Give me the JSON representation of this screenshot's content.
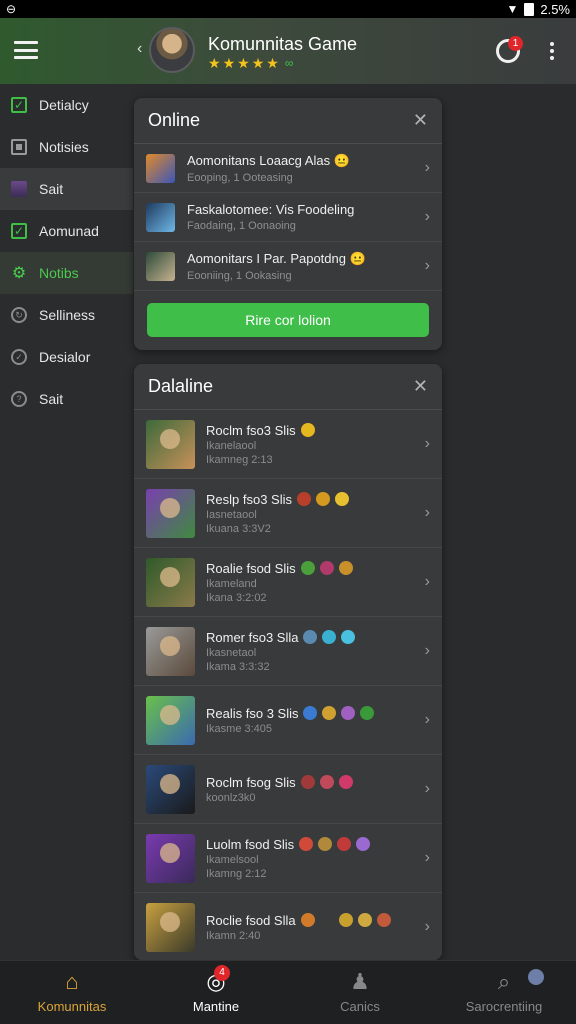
{
  "status_bar": {
    "left_icon": "system-icon",
    "battery": "2.5%"
  },
  "header": {
    "title": "Komunnitas Game",
    "rating_stars": 5,
    "rating_link": "∞",
    "notification_count": "1"
  },
  "sidebar": {
    "items": [
      {
        "label": "Detialcy",
        "icon": "check-icon"
      },
      {
        "label": "Notisies",
        "icon": "square-icon"
      },
      {
        "label": "Sait",
        "icon": "user-icon"
      },
      {
        "label": "Aomunad",
        "icon": "check-icon"
      },
      {
        "label": "Notibs",
        "icon": "gear-icon"
      },
      {
        "label": "Selliness",
        "icon": "circle-icon"
      },
      {
        "label": "Desialor",
        "icon": "circle-icon"
      },
      {
        "label": "Sait",
        "icon": "circle-icon"
      }
    ]
  },
  "online_card": {
    "title": "Online",
    "rows": [
      {
        "title": "Aomonitans Loaacg Alas 😐",
        "sub": "Eooping, 1 Ooteasing"
      },
      {
        "title": "Faskalotomee: Vis Foodeling",
        "sub": "Faodaing, 1 Oonaoing"
      },
      {
        "title": "Aomonitars I Par. Papotdng 😐",
        "sub": "Eooniing, 1 Ookasing"
      }
    ],
    "button": "Rire cor lolion"
  },
  "dalaline_card": {
    "title": "Dalaline",
    "rows": [
      {
        "title": "Roclm fso3 Slis",
        "line1": "Ikanelaool",
        "line2": "Ikamneg 2:13"
      },
      {
        "title": "Reslp fso3 Slis",
        "line1": "Iasnetaool",
        "line2": "Ikuana 3:3V2"
      },
      {
        "title": "Roalie fsod Slis",
        "line1": "Ikameland",
        "line2": "Ikana 3:2:02"
      },
      {
        "title": "Romer fso3 Slla",
        "line1": "Ikasnetaol",
        "line2": "Ikama 3:3:32"
      },
      {
        "title": "Realis fso 3 Slis",
        "line1": "Ikasme 3:405",
        "line2": ""
      },
      {
        "title": "Roclm fsog Slis",
        "line1": "koonlz3k0",
        "line2": ""
      },
      {
        "title": "Luolm fsod Slis",
        "line1": "Ikamelsool",
        "line2": "Ikamng 2:12"
      },
      {
        "title": "Roclie fsod Slla",
        "line1": "Ikamn 2:40",
        "line2": ""
      }
    ]
  },
  "bottom_nav": {
    "items": [
      {
        "label": "Komunnitas",
        "icon": "home-icon"
      },
      {
        "label": "Mantine",
        "icon": "chat-icon",
        "badge": "4"
      },
      {
        "label": "Canics",
        "icon": "person-icon"
      },
      {
        "label": "Sarocrentiing",
        "icon": "search-icon"
      }
    ]
  },
  "colors": {
    "accent_green": "#3fbe49",
    "header_green": "#2f5a2e",
    "badge_red": "#e0262b",
    "star_gold": "#f3c21c",
    "nav_active": "#d9a43a"
  }
}
